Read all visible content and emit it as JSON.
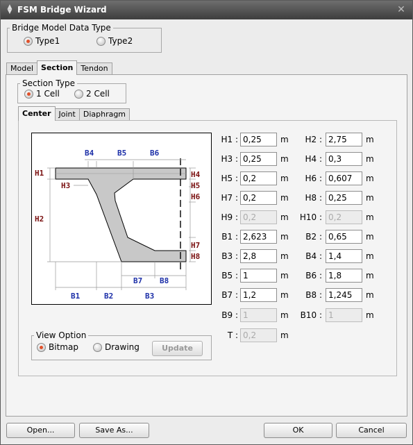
{
  "window": {
    "title": "FSM Bridge Wizard"
  },
  "icons": {
    "title": "app-icon",
    "close": "close-icon"
  },
  "bridge_type": {
    "legend": "Bridge Model Data Type",
    "options": [
      "Type1",
      "Type2"
    ],
    "selected": "Type1"
  },
  "main_tabs": [
    "Model",
    "Section",
    "Tendon"
  ],
  "section_type": {
    "legend": "Section Type",
    "options": [
      "1 Cell",
      "2 Cell"
    ],
    "selected": "1 Cell"
  },
  "sub_tabs": [
    "Center",
    "Joint",
    "Diaphragm"
  ],
  "diagram_labels": {
    "top": [
      "B4",
      "B5",
      "B6"
    ],
    "left": [
      "H1",
      "H3",
      "H2"
    ],
    "right": [
      "H4",
      "H5",
      "H6",
      "H7",
      "H8"
    ],
    "bottom_upper": [
      "B7",
      "B8"
    ],
    "bottom_lower": [
      "B1",
      "B2",
      "B3"
    ]
  },
  "view_option": {
    "legend": "View Option",
    "options": [
      "Bitmap",
      "Drawing"
    ],
    "selected": "Bitmap",
    "update": "Update"
  },
  "unit": "m",
  "params_left": [
    {
      "label": "H1 :",
      "value": "0,25",
      "enabled": true
    },
    {
      "label": "H3 :",
      "value": "0,25",
      "enabled": true
    },
    {
      "label": "H5 :",
      "value": "0,2",
      "enabled": true
    },
    {
      "label": "H7 :",
      "value": "0,2",
      "enabled": true
    },
    {
      "label": "H9 :",
      "value": "0,2",
      "enabled": false
    },
    {
      "label": "B1 :",
      "value": "2,623",
      "enabled": true
    },
    {
      "label": "B3 :",
      "value": "2,8",
      "enabled": true
    },
    {
      "label": "B5 :",
      "value": "1",
      "enabled": true
    },
    {
      "label": "B7 :",
      "value": "1,2",
      "enabled": true
    },
    {
      "label": "B9 :",
      "value": "1",
      "enabled": false
    },
    {
      "label": "T :",
      "value": "0,2",
      "enabled": false
    }
  ],
  "params_right": [
    {
      "label": "H2 :",
      "value": "2,75",
      "enabled": true
    },
    {
      "label": "H4 :",
      "value": "0,3",
      "enabled": true
    },
    {
      "label": "H6 :",
      "value": "0,607",
      "enabled": true
    },
    {
      "label": "H8 :",
      "value": "0,25",
      "enabled": true
    },
    {
      "label": "H10 :",
      "value": "0,2",
      "enabled": false
    },
    {
      "label": "B2 :",
      "value": "0,65",
      "enabled": true
    },
    {
      "label": "B4 :",
      "value": "1,4",
      "enabled": true
    },
    {
      "label": "B6 :",
      "value": "1,8",
      "enabled": true
    },
    {
      "label": "B8 :",
      "value": "1,245",
      "enabled": true
    },
    {
      "label": "B10 :",
      "value": "1",
      "enabled": false
    }
  ],
  "buttons": {
    "open": "Open...",
    "save_as": "Save As...",
    "ok": "OK",
    "cancel": "Cancel"
  },
  "colors": {
    "accent_radio": "#e0502a",
    "dim_blue": "#1c2fa8",
    "dim_red": "#7a1010",
    "section_fill": "#c8c8c8"
  }
}
